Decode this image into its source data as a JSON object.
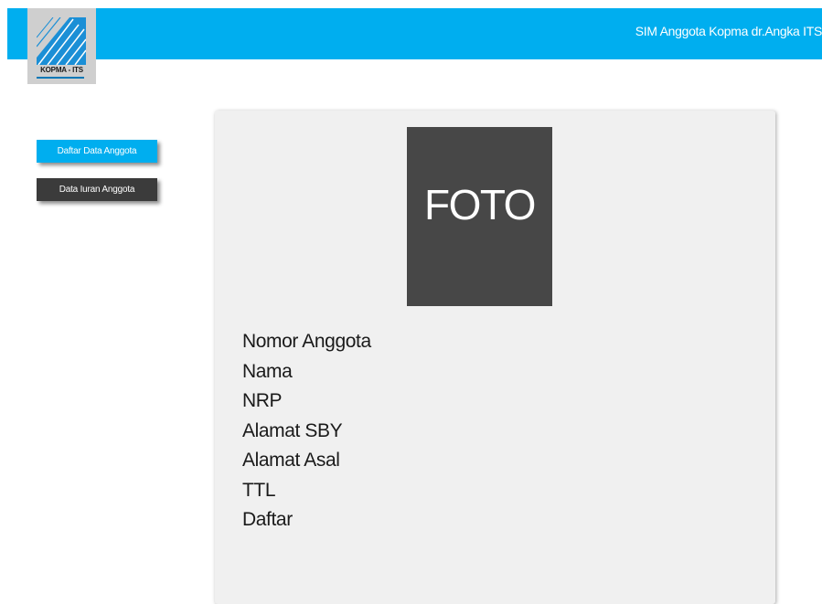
{
  "header": {
    "app_title": "SIM Anggota Kopma dr.Angka ITS",
    "bar_color": "#00aeef"
  },
  "logo": {
    "text": "KOPMA - ITS",
    "icon": "kopma-logo-icon"
  },
  "nav": {
    "items": [
      {
        "label": "Daftar Data Anggota",
        "active": true
      },
      {
        "label": "Data Iuran Anggota",
        "active": false
      }
    ]
  },
  "member": {
    "photo_placeholder": "FOTO",
    "fields": [
      "Nomor Anggota",
      "Nama",
      "NRP",
      "Alamat SBY",
      "Alamat Asal",
      "TTL",
      "Daftar"
    ]
  },
  "colors": {
    "accent": "#00aeef",
    "dark": "#3b3b3b",
    "photo_bg": "#474747",
    "panel_bg": "#f0f0f0"
  }
}
